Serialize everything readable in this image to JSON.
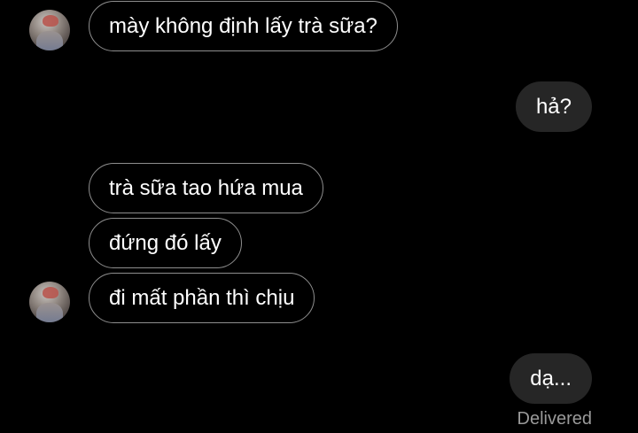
{
  "conversation": {
    "messages": [
      {
        "text": "mày không định lấy trà sữa?",
        "from": "them"
      },
      {
        "text": "hả?",
        "from": "me"
      },
      {
        "text": "trà sữa tao hứa mua",
        "from": "them"
      },
      {
        "text": "đứng đó lấy",
        "from": "them"
      },
      {
        "text": "đi mất phần thì chịu",
        "from": "them"
      },
      {
        "text": "dạ...",
        "from": "me"
      }
    ],
    "status": "Delivered"
  },
  "colors": {
    "background": "#000000",
    "received_border": "#8e8e8e",
    "sent_bubble": "#262626",
    "text": "#ffffff",
    "status_text": "#9a9a9a"
  }
}
